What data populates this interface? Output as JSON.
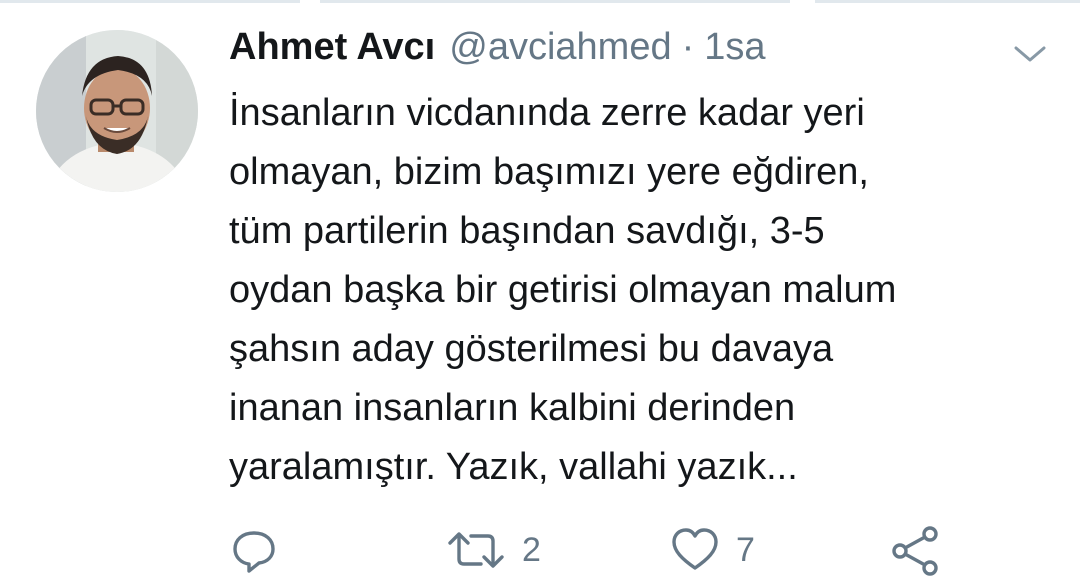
{
  "tweet": {
    "author_name": "Ahmet Avcı",
    "author_handle": "@avciahmed",
    "separator": "·",
    "time": "1sa",
    "text_lines": [
      "İnsanların vicdanında zerre kadar yeri",
      "olmayan, bizim başımızı yere eğdiren,",
      "tüm partilerin başından savdığı, 3-5",
      "oydan başka bir getirisi olmayan malum",
      "şahsın aday gösterilmesi bu davaya",
      "inanan insanların kalbini derinden",
      "yaralamıştır. Yazık, vallahi yazık..."
    ]
  },
  "actions": {
    "reply_icon": "reply-icon",
    "retweet_icon": "retweet-icon",
    "retweet_count": "2",
    "like_icon": "heart-icon",
    "like_count": "7",
    "share_icon": "share-icon"
  },
  "colors": {
    "text": "#14171a",
    "secondary": "#657786",
    "divider": "#e1e8ed"
  }
}
